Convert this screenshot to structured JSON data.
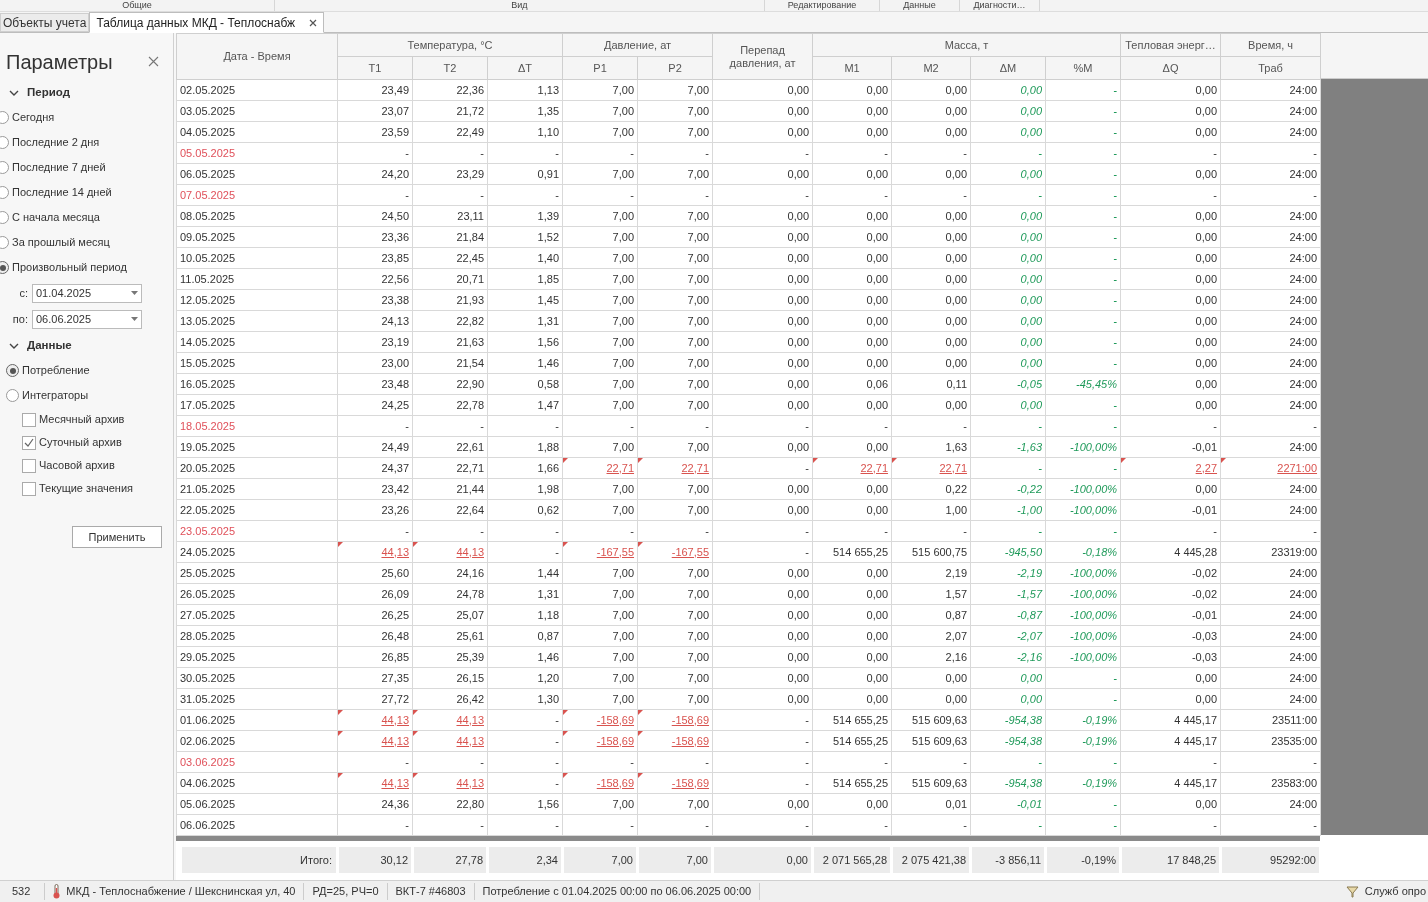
{
  "ribbon_groups": [
    "Общие",
    "Вид",
    "Редактирование",
    "Данные",
    "Диагности…"
  ],
  "tabs": [
    {
      "label": "Объекты учета",
      "selected": false,
      "closable": false
    },
    {
      "label": "Таблица данных МКД - Теплоснабж",
      "selected": true,
      "closable": true
    }
  ],
  "panel": {
    "title": "Параметры",
    "period": {
      "title": "Период",
      "expanded": true,
      "options": [
        {
          "label": "Сегодня",
          "selected": false
        },
        {
          "label": "Последние 2 дня",
          "selected": false
        },
        {
          "label": "Последние 7 дней",
          "selected": false
        },
        {
          "label": "Последние 14 дней",
          "selected": false
        },
        {
          "label": "С начала месяца",
          "selected": false
        },
        {
          "label": "За прошлый месяц",
          "selected": false
        },
        {
          "label": "Произвольный период",
          "selected": true
        }
      ],
      "from": {
        "label": "с:",
        "value": "01.04.2025"
      },
      "to": {
        "label": "по:",
        "value": "06.06.2025"
      }
    },
    "data": {
      "title": "Данные",
      "expanded": true,
      "options": [
        {
          "label": "Потребление",
          "selected": true
        },
        {
          "label": "Интеграторы",
          "selected": false
        }
      ],
      "archives": [
        {
          "label": "Месячный архив",
          "checked": false
        },
        {
          "label": "Суточный архив",
          "checked": true
        },
        {
          "label": "Часовой архив",
          "checked": false
        },
        {
          "label": "Текущие значения",
          "checked": false
        }
      ]
    },
    "apply_button": "Применить"
  },
  "table": {
    "column_groups": [
      {
        "label": "Дата - Время"
      },
      {
        "label": "Температура, °С",
        "columns": [
          {
            "label": "T1",
            "kind": "number"
          },
          {
            "label": "T2",
            "kind": "number"
          },
          {
            "label": "ΔT",
            "kind": "number"
          }
        ]
      },
      {
        "label": "Давление, ат",
        "columns": [
          {
            "label": "P1",
            "kind": "number"
          },
          {
            "label": "P2",
            "kind": "number"
          }
        ]
      },
      {
        "label": "Перепад давления, ат",
        "kind": "number"
      },
      {
        "label": "Масса, т",
        "columns": [
          {
            "label": "M1",
            "kind": "number"
          },
          {
            "label": "M2",
            "kind": "number"
          },
          {
            "label": "ΔM",
            "kind": "delta"
          },
          {
            "label": "%M",
            "kind": "delta"
          }
        ]
      },
      {
        "label": "Тепловая энерг…",
        "columns": [
          {
            "label": "ΔQ",
            "kind": "number"
          }
        ]
      },
      {
        "label": "Время, ч",
        "columns": [
          {
            "label": "Траб",
            "kind": "number"
          }
        ]
      }
    ],
    "rows": [
      {
        "date": "02.05.2025",
        "highlighted": false,
        "cells": [
          "23,49",
          "22,36",
          "1,13",
          "7,00",
          "7,00",
          "0,00",
          "0,00",
          "0,00",
          "0,00",
          "-",
          "0,00",
          "24:00"
        ]
      },
      {
        "date": "03.05.2025",
        "highlighted": false,
        "cells": [
          "23,07",
          "21,72",
          "1,35",
          "7,00",
          "7,00",
          "0,00",
          "0,00",
          "0,00",
          "0,00",
          "-",
          "0,00",
          "24:00"
        ]
      },
      {
        "date": "04.05.2025",
        "highlighted": false,
        "cells": [
          "23,59",
          "22,49",
          "1,10",
          "7,00",
          "7,00",
          "0,00",
          "0,00",
          "0,00",
          "0,00",
          "-",
          "0,00",
          "24:00"
        ]
      },
      {
        "date": "05.05.2025",
        "highlighted": true,
        "cells": [
          "-",
          "-",
          "-",
          "-",
          "-",
          "-",
          "-",
          "-",
          "-",
          "-",
          "-",
          "-"
        ]
      },
      {
        "date": "06.05.2025",
        "highlighted": false,
        "cells": [
          "24,20",
          "23,29",
          "0,91",
          "7,00",
          "7,00",
          "0,00",
          "0,00",
          "0,00",
          "0,00",
          "-",
          "0,00",
          "24:00"
        ]
      },
      {
        "date": "07.05.2025",
        "highlighted": true,
        "cells": [
          "-",
          "-",
          "-",
          "-",
          "-",
          "-",
          "-",
          "-",
          "-",
          "-",
          "-",
          "-"
        ]
      },
      {
        "date": "08.05.2025",
        "highlighted": false,
        "cells": [
          "24,50",
          "23,11",
          "1,39",
          "7,00",
          "7,00",
          "0,00",
          "0,00",
          "0,00",
          "0,00",
          "-",
          "0,00",
          "24:00"
        ]
      },
      {
        "date": "09.05.2025",
        "highlighted": false,
        "cells": [
          "23,36",
          "21,84",
          "1,52",
          "7,00",
          "7,00",
          "0,00",
          "0,00",
          "0,00",
          "0,00",
          "-",
          "0,00",
          "24:00"
        ]
      },
      {
        "date": "10.05.2025",
        "highlighted": false,
        "cells": [
          "23,85",
          "22,45",
          "1,40",
          "7,00",
          "7,00",
          "0,00",
          "0,00",
          "0,00",
          "0,00",
          "-",
          "0,00",
          "24:00"
        ]
      },
      {
        "date": "11.05.2025",
        "highlighted": false,
        "cells": [
          "22,56",
          "20,71",
          "1,85",
          "7,00",
          "7,00",
          "0,00",
          "0,00",
          "0,00",
          "0,00",
          "-",
          "0,00",
          "24:00"
        ]
      },
      {
        "date": "12.05.2025",
        "highlighted": false,
        "cells": [
          "23,38",
          "21,93",
          "1,45",
          "7,00",
          "7,00",
          "0,00",
          "0,00",
          "0,00",
          "0,00",
          "-",
          "0,00",
          "24:00"
        ]
      },
      {
        "date": "13.05.2025",
        "highlighted": false,
        "cells": [
          "24,13",
          "22,82",
          "1,31",
          "7,00",
          "7,00",
          "0,00",
          "0,00",
          "0,00",
          "0,00",
          "-",
          "0,00",
          "24:00"
        ]
      },
      {
        "date": "14.05.2025",
        "highlighted": false,
        "cells": [
          "23,19",
          "21,63",
          "1,56",
          "7,00",
          "7,00",
          "0,00",
          "0,00",
          "0,00",
          "0,00",
          "-",
          "0,00",
          "24:00"
        ]
      },
      {
        "date": "15.05.2025",
        "highlighted": false,
        "cells": [
          "23,00",
          "21,54",
          "1,46",
          "7,00",
          "7,00",
          "0,00",
          "0,00",
          "0,00",
          "0,00",
          "-",
          "0,00",
          "24:00"
        ]
      },
      {
        "date": "16.05.2025",
        "highlighted": false,
        "cells": [
          "23,48",
          "22,90",
          "0,58",
          "7,00",
          "7,00",
          "0,00",
          "0,06",
          "0,11",
          "-0,05",
          "-45,45%",
          "0,00",
          "24:00"
        ]
      },
      {
        "date": "17.05.2025",
        "highlighted": false,
        "cells": [
          "24,25",
          "22,78",
          "1,47",
          "7,00",
          "7,00",
          "0,00",
          "0,00",
          "0,00",
          "0,00",
          "-",
          "0,00",
          "24:00"
        ]
      },
      {
        "date": "18.05.2025",
        "highlighted": true,
        "cells": [
          "-",
          "-",
          "-",
          "-",
          "-",
          "-",
          "-",
          "-",
          "-",
          "-",
          "-",
          "-"
        ]
      },
      {
        "date": "19.05.2025",
        "highlighted": false,
        "cells": [
          "24,49",
          "22,61",
          "1,88",
          "7,00",
          "7,00",
          "0,00",
          "0,00",
          "1,63",
          "-1,63",
          "-100,00%",
          "-0,01",
          "24:00"
        ]
      },
      {
        "date": "20.05.2025",
        "highlighted": false,
        "cells": [
          "24,37",
          "22,71",
          "1,66",
          {
            "text": "22,71",
            "invalid": true
          },
          {
            "text": "22,71",
            "invalid": true
          },
          "-",
          {
            "text": "22,71",
            "invalid": true
          },
          {
            "text": "22,71",
            "invalid": true
          },
          "-",
          "-",
          {
            "text": "2,27",
            "invalid": true
          },
          {
            "text": "2271:00",
            "invalid": true
          }
        ]
      },
      {
        "date": "21.05.2025",
        "highlighted": false,
        "cells": [
          "23,42",
          "21,44",
          "1,98",
          "7,00",
          "7,00",
          "0,00",
          "0,00",
          "0,22",
          "-0,22",
          "-100,00%",
          "0,00",
          "24:00"
        ]
      },
      {
        "date": "22.05.2025",
        "highlighted": false,
        "cells": [
          "23,26",
          "22,64",
          "0,62",
          "7,00",
          "7,00",
          "0,00",
          "0,00",
          "1,00",
          "-1,00",
          "-100,00%",
          "-0,01",
          "24:00"
        ]
      },
      {
        "date": "23.05.2025",
        "highlighted": true,
        "cells": [
          "-",
          "-",
          "-",
          "-",
          "-",
          "-",
          "-",
          "-",
          "-",
          "-",
          "-",
          "-"
        ]
      },
      {
        "date": "24.05.2025",
        "highlighted": false,
        "cells": [
          {
            "text": "44,13",
            "invalid": true
          },
          {
            "text": "44,13",
            "invalid": true
          },
          "-",
          {
            "text": "-167,55",
            "invalid": true
          },
          {
            "text": "-167,55",
            "invalid": true
          },
          "-",
          "514 655,25",
          "515 600,75",
          "-945,50",
          "-0,18%",
          "4 445,28",
          "23319:00"
        ]
      },
      {
        "date": "25.05.2025",
        "highlighted": false,
        "cells": [
          "25,60",
          "24,16",
          "1,44",
          "7,00",
          "7,00",
          "0,00",
          "0,00",
          "2,19",
          "-2,19",
          "-100,00%",
          "-0,02",
          "24:00"
        ]
      },
      {
        "date": "26.05.2025",
        "highlighted": false,
        "cells": [
          "26,09",
          "24,78",
          "1,31",
          "7,00",
          "7,00",
          "0,00",
          "0,00",
          "1,57",
          "-1,57",
          "-100,00%",
          "-0,02",
          "24:00"
        ]
      },
      {
        "date": "27.05.2025",
        "highlighted": false,
        "cells": [
          "26,25",
          "25,07",
          "1,18",
          "7,00",
          "7,00",
          "0,00",
          "0,00",
          "0,87",
          "-0,87",
          "-100,00%",
          "-0,01",
          "24:00"
        ]
      },
      {
        "date": "28.05.2025",
        "highlighted": false,
        "cells": [
          "26,48",
          "25,61",
          "0,87",
          "7,00",
          "7,00",
          "0,00",
          "0,00",
          "2,07",
          "-2,07",
          "-100,00%",
          "-0,03",
          "24:00"
        ]
      },
      {
        "date": "29.05.2025",
        "highlighted": false,
        "cells": [
          "26,85",
          "25,39",
          "1,46",
          "7,00",
          "7,00",
          "0,00",
          "0,00",
          "2,16",
          "-2,16",
          "-100,00%",
          "-0,03",
          "24:00"
        ]
      },
      {
        "date": "30.05.2025",
        "highlighted": false,
        "cells": [
          "27,35",
          "26,15",
          "1,20",
          "7,00",
          "7,00",
          "0,00",
          "0,00",
          "0,00",
          "0,00",
          "-",
          "0,00",
          "24:00"
        ]
      },
      {
        "date": "31.05.2025",
        "highlighted": false,
        "cells": [
          "27,72",
          "26,42",
          "1,30",
          "7,00",
          "7,00",
          "0,00",
          "0,00",
          "0,00",
          "0,00",
          "-",
          "0,00",
          "24:00"
        ]
      },
      {
        "date": "01.06.2025",
        "highlighted": false,
        "cells": [
          {
            "text": "44,13",
            "invalid": true
          },
          {
            "text": "44,13",
            "invalid": true
          },
          "-",
          {
            "text": "-158,69",
            "invalid": true
          },
          {
            "text": "-158,69",
            "invalid": true
          },
          "-",
          "514 655,25",
          "515 609,63",
          "-954,38",
          "-0,19%",
          "4 445,17",
          "23511:00"
        ]
      },
      {
        "date": "02.06.2025",
        "highlighted": false,
        "cells": [
          {
            "text": "44,13",
            "invalid": true
          },
          {
            "text": "44,13",
            "invalid": true
          },
          "-",
          {
            "text": "-158,69",
            "invalid": true
          },
          {
            "text": "-158,69",
            "invalid": true
          },
          "-",
          "514 655,25",
          "515 609,63",
          "-954,38",
          "-0,19%",
          "4 445,17",
          "23535:00"
        ]
      },
      {
        "date": "03.06.2025",
        "highlighted": true,
        "cells": [
          "-",
          "-",
          "-",
          "-",
          "-",
          "-",
          "-",
          "-",
          "-",
          "-",
          "-",
          "-"
        ]
      },
      {
        "date": "04.06.2025",
        "highlighted": false,
        "cells": [
          {
            "text": "44,13",
            "invalid": true
          },
          {
            "text": "44,13",
            "invalid": true
          },
          "-",
          {
            "text": "-158,69",
            "invalid": true
          },
          {
            "text": "-158,69",
            "invalid": true
          },
          "-",
          "514 655,25",
          "515 609,63",
          "-954,38",
          "-0,19%",
          "4 445,17",
          "23583:00"
        ]
      },
      {
        "date": "05.06.2025",
        "highlighted": false,
        "cells": [
          "24,36",
          "22,80",
          "1,56",
          "7,00",
          "7,00",
          "0,00",
          "0,00",
          "0,01",
          "-0,01",
          "-",
          "0,00",
          "24:00"
        ]
      },
      {
        "date": "06.06.2025",
        "highlighted": false,
        "cells": [
          "-",
          "-",
          "-",
          "-",
          "-",
          "-",
          "-",
          "-",
          "-",
          "-",
          "-",
          "-"
        ]
      }
    ],
    "totals": {
      "label": "Итого:",
      "cells": [
        "30,12",
        "27,78",
        "2,34",
        "7,00",
        "7,00",
        "0,00",
        "2 071 565,28",
        "2 075 421,38",
        "-3 856,11",
        "-0,19%",
        "17 848,25",
        "95292:00"
      ]
    }
  },
  "status_bar": {
    "count": "532",
    "object": "МКД - Теплоснабжение / Шекснинская ул, 40",
    "channels": "РД=25, РЧ=0",
    "device": "ВКТ-7 #46803",
    "range": "Потребление с 01.04.2025 00:00 по 06.06.2025 00:00",
    "service": "Служб опро"
  }
}
